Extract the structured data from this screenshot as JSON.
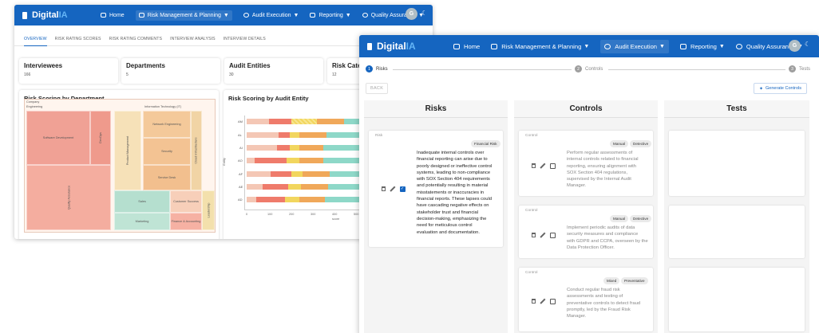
{
  "back_window": {
    "logo": {
      "prefix": "Digital",
      "suffix": "IA"
    },
    "nav": {
      "home": "Home",
      "risk": "Risk Management & Planning",
      "audit": "Audit Execution",
      "reporting": "Reporting",
      "quality": "Quality Assurance"
    },
    "avatar_initial": "G",
    "tabs": [
      "OVERVIEW",
      "RISK RATING SCORES",
      "RISK RATING COMMENTS",
      "INTERVIEW ANALYSIS",
      "INTERVIEW DETAILS"
    ],
    "stats": [
      {
        "title": "Interviewees",
        "value": "166"
      },
      {
        "title": "Departments",
        "value": "5"
      },
      {
        "title": "Audit Entities",
        "value": "30"
      },
      {
        "title": "Risk Categ",
        "value": "12"
      }
    ],
    "treemap": {
      "title": "Risk Scoring by Department",
      "header_company": "Company",
      "header_engineering": "Engineering",
      "header_it": "Information Technology (IT)",
      "software_dev": "Software Development",
      "devops": "DevOps",
      "qa": "Quality Assurance",
      "product_mgmt": "Product Management",
      "network_eng": "Network Engineering",
      "security": "Security",
      "service_desk": "Service Desk",
      "sales": "Sales",
      "customer_success": "Customer Success",
      "marketing": "Marketing",
      "finance": "Finance & Accounting",
      "cloud": "Cloud Infrastructure",
      "leadership": "Leadership"
    },
    "bar_chart": {
      "title": "Risk Scoring by Audit Entity",
      "rows": [
        "AM",
        "AL",
        "AI",
        "AO",
        "AF",
        "AE",
        "AD"
      ],
      "y_label": "Entity",
      "x_ticks": [
        "0",
        "100",
        "200",
        "300",
        "400",
        "500"
      ],
      "x_label": "score"
    }
  },
  "front_window": {
    "logo": {
      "prefix": "Digital",
      "suffix": "IA"
    },
    "nav": {
      "home": "Home",
      "risk": "Risk Management & Planning",
      "audit": "Audit Execution",
      "reporting": "Reporting",
      "quality": "Quality Assurance"
    },
    "avatar_initial": "G",
    "steps": [
      {
        "num": "1",
        "label": "Risks"
      },
      {
        "num": "2",
        "label": "Controls"
      },
      {
        "num": "3",
        "label": "Tests"
      }
    ],
    "back_label": "BACK",
    "generate_label": "Generate Controls",
    "columns": {
      "risks": "Risks",
      "controls": "Controls",
      "tests": "Tests"
    },
    "risk_card": {
      "label": "Risk",
      "chip": "Financial Risk",
      "lines": [
        "Inadequate internal controls over",
        "financial reporting can arise due to",
        "poorly designed or ineffective control",
        "systems, leading to non-compliance",
        "with SOX Section 404 requirements",
        "and potentially resulting in material",
        "misstatements or inaccuracies in",
        "financial reports. These lapses could",
        "have cascading negative effects on",
        "stakeholder trust and financial",
        "decision-making, emphasizing the",
        "need for meticulous control",
        "evaluation and documentation."
      ]
    },
    "control_cards": [
      {
        "label": "Control",
        "chips": [
          "Manual",
          "Detective"
        ],
        "lines": [
          "Perform regular assessments of",
          "internal controls related to financial",
          "reporting, ensuring alignment with",
          "SOX Section 404 regulations,",
          "supervised by the Internal Audit",
          "Manager."
        ]
      },
      {
        "label": "Control",
        "chips": [
          "Manual",
          "Detective"
        ],
        "lines": [
          "Implement periodic audits of data",
          "security measures and compliance",
          "with GDPR and CCPA, overseen by the",
          "Data Protection Officer."
        ]
      },
      {
        "label": "Control",
        "chips": [
          "Mixed",
          "Preventative"
        ],
        "lines": [
          "Conduct regular fraud risk",
          "assessments and testing of",
          "preventative controls to detect fraud",
          "promptly, led by the Fraud Risk",
          "Manager."
        ]
      }
    ]
  }
}
